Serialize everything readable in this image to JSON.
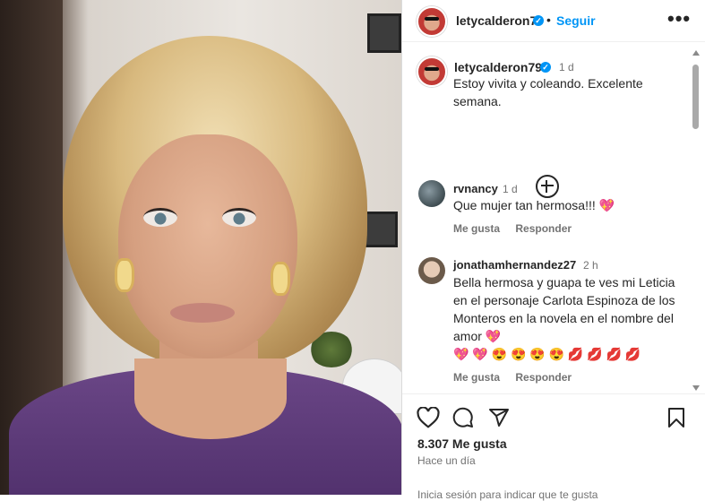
{
  "post_header": {
    "username": "letycalderon79",
    "verified_mark": "✓",
    "separator": "•",
    "follow_label": "Seguir",
    "more_label": "•••"
  },
  "caption": {
    "username": "letycalderon79",
    "time": "1 d",
    "text": "Estoy vivita y coleando. Excelente semana."
  },
  "comments": [
    {
      "username": "rvnancy",
      "time": "1 d",
      "text": "Que mujer tan hermosa!!! 💖",
      "like_label": "Me gusta",
      "reply_label": "Responder"
    },
    {
      "username": "jonathamhernandez27",
      "time": "2 h",
      "text": "Bella hermosa y guapa te ves mi Leticia en el personaje Carlota Espinoza de los Monteros en la novela en el nombre del amor 💖",
      "emojis": "💖 💖 😍 😍 😍 😍 💋 💋 💋 💋",
      "like_label": "Me gusta",
      "reply_label": "Responder"
    }
  ],
  "footer": {
    "likes": "8.307 Me gusta",
    "posted": "Hace un día",
    "add_comment_cut": "Inicia sesión para indicar que te gusta"
  },
  "icons": {
    "like": "heart-icon",
    "comment": "comment-icon",
    "share": "share-icon",
    "save": "bookmark-icon",
    "load_more": "plus-circle-icon"
  },
  "colors": {
    "link_blue": "#0095f6",
    "text": "#262626",
    "muted": "#737373",
    "heart": "#ed4956"
  }
}
